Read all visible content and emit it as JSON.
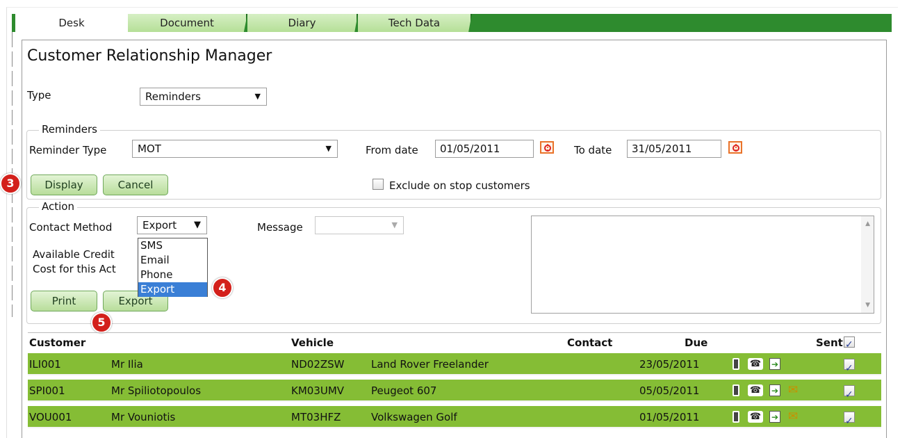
{
  "tabs": [
    {
      "label": "Desk",
      "active": true
    },
    {
      "label": "Document",
      "active": false
    },
    {
      "label": "Diary",
      "active": false
    },
    {
      "label": "Tech Data",
      "active": false
    }
  ],
  "page_title": "Customer Relationship Manager",
  "type": {
    "label": "Type",
    "value": "Reminders"
  },
  "reminders": {
    "legend": "Reminders",
    "reminder_type_label": "Reminder Type",
    "reminder_type_value": "MOT",
    "from_date_label": "From date",
    "from_date_value": "01/05/2011",
    "to_date_label": "To date",
    "to_date_value": "31/05/2011",
    "display_button": "Display",
    "cancel_button": "Cancel",
    "exclude_label": "Exclude on stop customers",
    "exclude_checked": false
  },
  "action": {
    "legend": "Action",
    "contact_method_label": "Contact Method",
    "contact_method_value": "Export",
    "contact_method_options": [
      "SMS",
      "Email",
      "Phone",
      "Export"
    ],
    "message_label": "Message",
    "message_value": "",
    "available_credit_label": "Available Credit",
    "cost_label": "Cost for this Act",
    "print_button": "Print",
    "export_button": "Export"
  },
  "markers": [
    "3",
    "4",
    "5"
  ],
  "table": {
    "headers": {
      "customer": "Customer",
      "vehicle": "Vehicle",
      "contact": "Contact",
      "due": "Due",
      "sent": "Sent"
    },
    "header_sent_checked": true,
    "rows": [
      {
        "code": "ILI001",
        "name": "Mr Ilia",
        "reg": "ND02ZSW",
        "model": "Land Rover Freelander",
        "due": "23/05/2011",
        "icons": [
          "mobile-icon",
          "phone-icon",
          "export-icon"
        ],
        "sent": true
      },
      {
        "code": "SPI001",
        "name": "Mr Spiliotopoulos",
        "reg": "KM03UMV",
        "model": "Peugeot 607",
        "due": "05/05/2011",
        "icons": [
          "mobile-icon",
          "phone-icon",
          "export-icon",
          "mail-icon"
        ],
        "sent": true
      },
      {
        "code": "VOU001",
        "name": "Mr Vouniotis",
        "reg": "MT03HFZ",
        "model": "Volkswagen Golf",
        "due": "01/05/2011",
        "icons": [
          "mobile-icon",
          "phone-icon",
          "export-icon",
          "mail-icon"
        ],
        "sent": true
      }
    ]
  },
  "colors": {
    "tab_bar": "#2e8b2e",
    "row_bg": "#85bd35",
    "marker": "#d3201b",
    "selected_option": "#3a7fd6"
  }
}
